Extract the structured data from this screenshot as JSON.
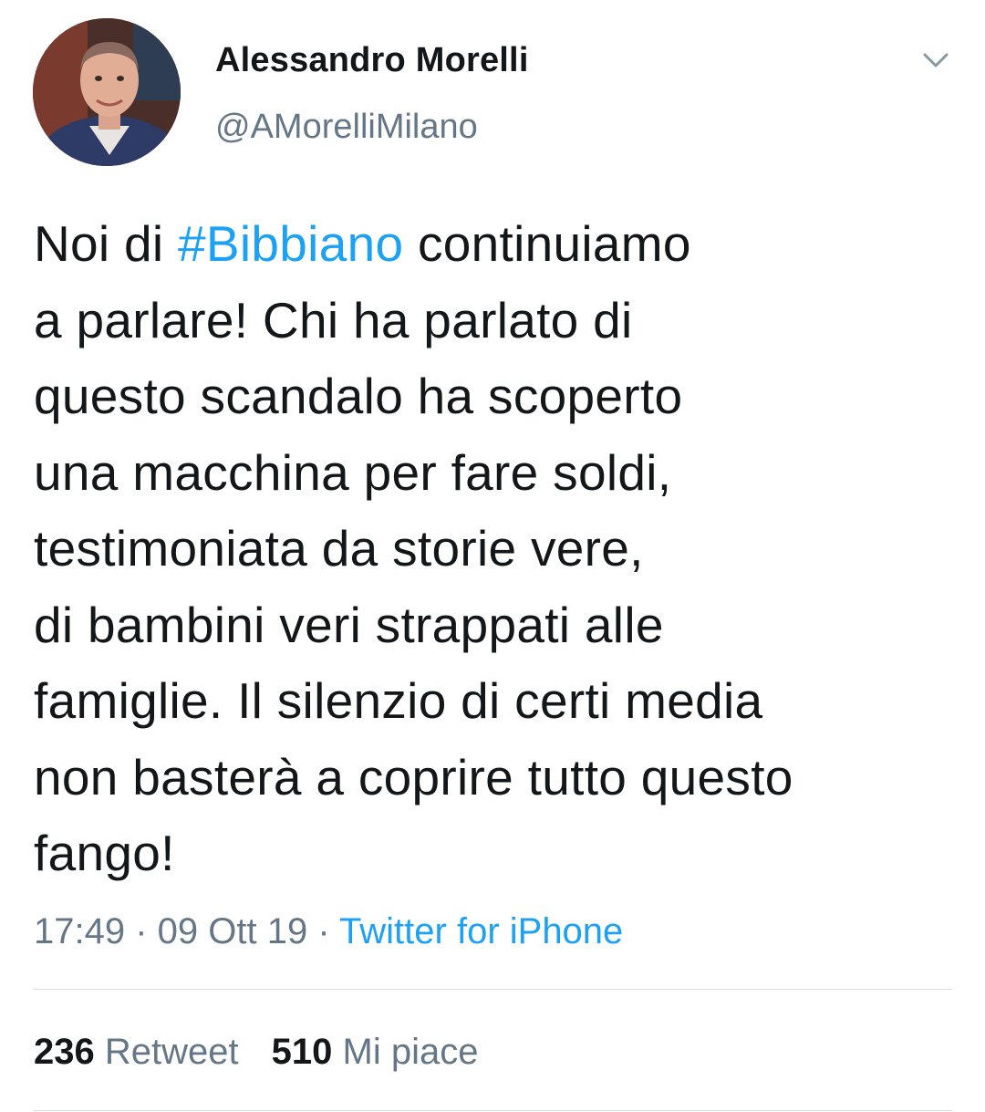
{
  "author": {
    "display_name": "Alessandro Morelli",
    "handle": "@AMorelliMilano",
    "avatar": "profile-photo"
  },
  "tweet": {
    "lines": [
      {
        "before": "Noi di ",
        "hashtag": "#Bibbiano",
        "after": " continuiamo"
      },
      {
        "text": "a parlare! Chi ha parlato di"
      },
      {
        "text": "questo scandalo ha scoperto"
      },
      {
        "text": "una macchina per fare soldi,"
      },
      {
        "text": "testimoniata da storie vere,"
      },
      {
        "text": "di bambini veri strappati alle"
      },
      {
        "text": "famiglie. Il silenzio di certi media"
      },
      {
        "text": "non basterà a coprire tutto questo"
      },
      {
        "text": "fango!"
      }
    ]
  },
  "meta": {
    "time": "17:49",
    "separator": " · ",
    "date": "09 Ott 19",
    "source": "Twitter for iPhone"
  },
  "stats": {
    "retweets": {
      "count": "236",
      "label": "Retweet"
    },
    "likes": {
      "count": "510",
      "label": "Mi piace"
    }
  },
  "icons": {
    "menu": "chevron-down-icon"
  },
  "colors": {
    "link": "#1da1f2",
    "secondary": "#657786",
    "primary": "#14171a",
    "divider": "#d6dde3"
  }
}
